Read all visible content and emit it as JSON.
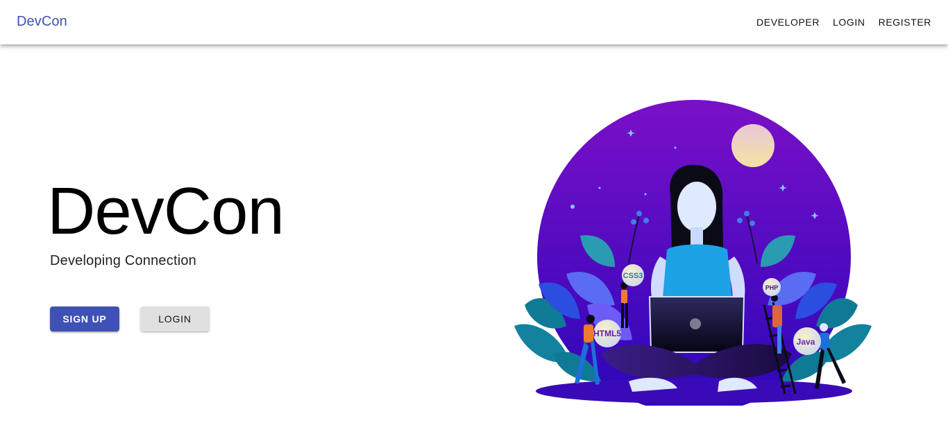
{
  "header": {
    "brand": "DevCon",
    "nav": [
      {
        "label": "DEVELOPER"
      },
      {
        "label": "LOGIN"
      },
      {
        "label": "REGISTER"
      }
    ]
  },
  "hero": {
    "title": "DevCon",
    "subtitle": "Developing Connection",
    "signup_label": "SIGN UP",
    "login_label": "LOGIN"
  },
  "illustration": {
    "badges": {
      "css": "CSS3",
      "html": "HTML5",
      "php": "PHP",
      "java": "Java"
    }
  },
  "colors": {
    "primary": "#3f51b5",
    "secondary_button": "#e0e0e0",
    "circle_top": "#7a10c8",
    "circle_bottom": "#2a06b8",
    "leaf_teal": "#0f7a96",
    "shirt_blue": "#1ea2e6"
  }
}
